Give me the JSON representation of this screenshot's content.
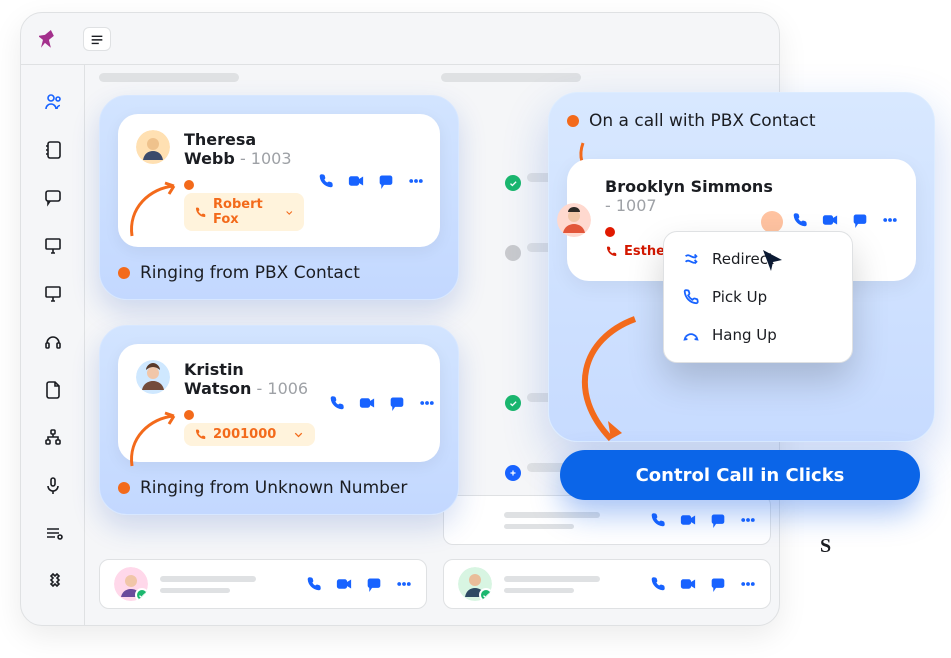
{
  "sidebar": {
    "items": [
      "people",
      "contacts",
      "chat",
      "monitor-a",
      "monitor-b",
      "headset",
      "doc",
      "org",
      "mic",
      "recent",
      "extension"
    ],
    "active_index": 0
  },
  "cards": {
    "ringing_contact": {
      "name": "Theresa Webb",
      "ext": "1003",
      "status_dot": "orange",
      "chip_text": "Robert Fox",
      "label": "Ringing from PBX Contact"
    },
    "ringing_unknown": {
      "name": "Kristin Watson",
      "ext": "1006",
      "status_dot": "orange",
      "chip_text": "2001000",
      "label": "Ringing from Unknown Number"
    },
    "on_call": {
      "title": "On a call with PBX Contact",
      "name": "Brooklyn Simmons",
      "ext": "1007",
      "status_dot": "red",
      "chip_text": "Esther Howard"
    }
  },
  "menu": {
    "items": [
      "Redirect",
      "Pick Up",
      "Hang Up"
    ]
  },
  "cta": "Control Call in Clicks",
  "actions": {
    "call": "call",
    "video": "video",
    "chat": "chat",
    "more": "more"
  },
  "colors": {
    "blue": "#1863ff",
    "orange": "#f36a1b",
    "green": "#1bb76e"
  }
}
